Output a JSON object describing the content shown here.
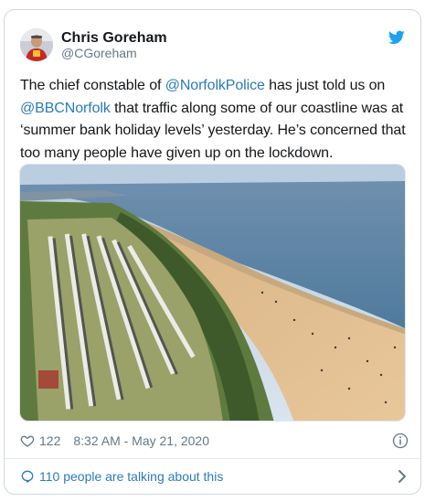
{
  "author": {
    "display_name": "Chris Goreham",
    "handle": "@CGoreham"
  },
  "tweet": {
    "text_1": "The chief constable of ",
    "mention_1": "@NorfolkPolice",
    "text_2": " has just told us on ",
    "mention_2": "@BBCNorfolk",
    "text_3": " that traffic along some of our coastline was at ‘summer bank holiday levels’ yesterday. He’s concerned that too many people have given up on the lockdown."
  },
  "media": {
    "icon": "aerial-photo"
  },
  "meta": {
    "like_count": "122",
    "timestamp": "8:32 AM - May 21, 2020"
  },
  "conversation": {
    "label": "110 people are talking about this"
  },
  "colors": {
    "link": "#2b7bb9",
    "twitter_blue": "#1da1f2",
    "secondary_text": "#657786"
  },
  "icons": {
    "brand": "twitter-bird-icon",
    "like": "heart-icon",
    "info": "info-icon",
    "reply": "speech-bubble-icon",
    "more": "chevron-right-icon"
  }
}
